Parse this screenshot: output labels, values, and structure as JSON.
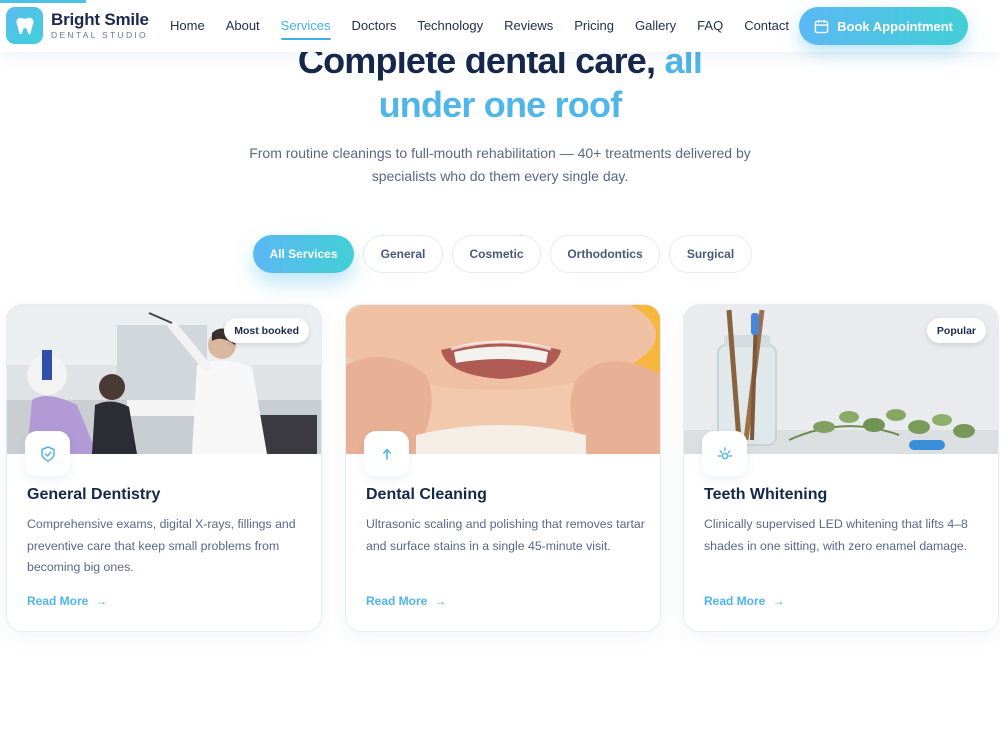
{
  "header": {
    "logo_name": "Bright Smile",
    "logo_sub": "DENTAL STUDIO",
    "nav": [
      "Home",
      "About",
      "Services",
      "Doctors",
      "Technology",
      "Reviews",
      "Pricing",
      "Gallery",
      "FAQ",
      "Contact"
    ],
    "active_nav": "Services",
    "book_label": "Book Appointment"
  },
  "hero": {
    "title_part1": "Complete dental care,",
    "title_highlight": "all",
    "title_line2": "under one roof",
    "subtitle": "From routine cleanings to full-mouth rehabilitation — 40+ treatments delivered by specialists who do them every single day."
  },
  "filters": {
    "items": [
      "All Services",
      "General",
      "Cosmetic",
      "Orthodontics",
      "Surgical"
    ],
    "active": "All Services"
  },
  "cards": [
    {
      "badge": "Most booked",
      "title": "General Dentistry",
      "description": "Comprehensive exams, digital X-rays, fillings and preventive care that keep small problems from becoming big ones.",
      "link": "Read More",
      "icon": "shield-check-icon"
    },
    {
      "badge": "",
      "title": "Dental Cleaning",
      "description": "Ultrasonic scaling and polishing that removes tartar and surface stains in a single 45-minute visit.",
      "link": "Read More",
      "icon": "arrow-up-icon"
    },
    {
      "badge": "Popular",
      "title": "Teeth Whitening",
      "description": "Clinically supervised LED whitening that lifts 4–8 shades in one sitting, with zero enamel damage.",
      "link": "Read More",
      "icon": "sun-icon"
    }
  ],
  "colors": {
    "accent": "#4fb6ea",
    "accent_gradient_end": "#42cfd6",
    "heading": "#16284a",
    "body_text": "#5a6883"
  }
}
